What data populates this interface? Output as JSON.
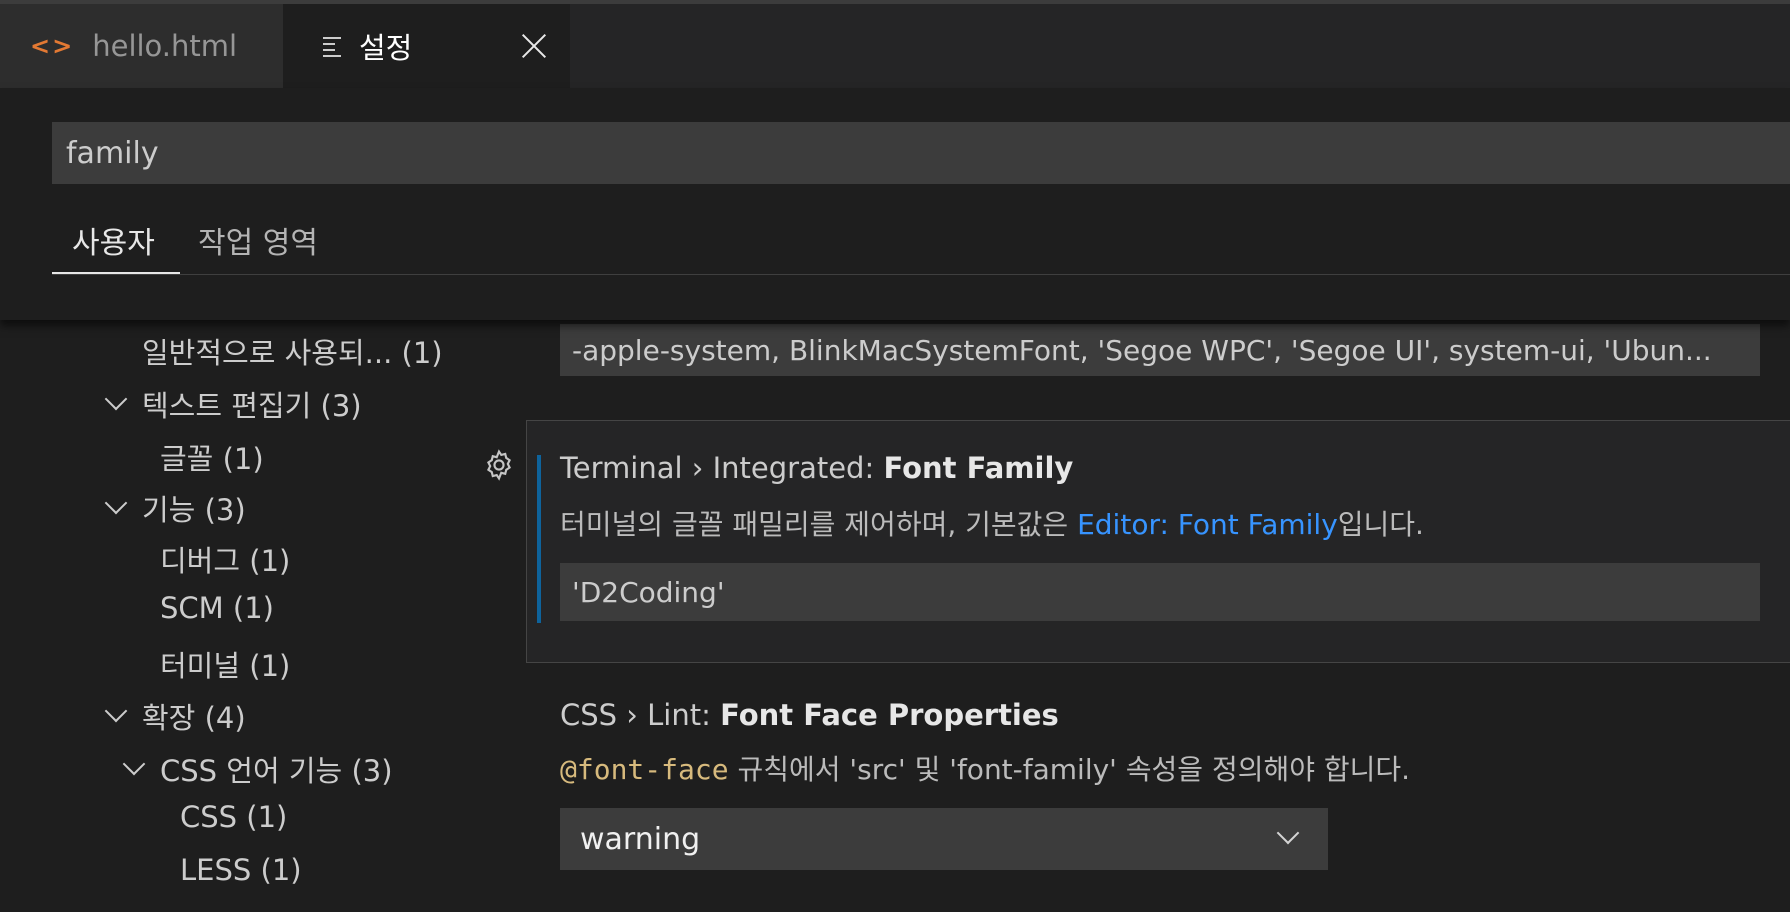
{
  "tabs": {
    "hello": {
      "label": "hello.html",
      "icon": "code-icon"
    },
    "settings": {
      "label": "설정",
      "icon": "settings-lines-icon"
    }
  },
  "search": {
    "value": "family"
  },
  "scope_tabs": {
    "user": "사용자",
    "workspace": "작업 영역"
  },
  "toc": {
    "items": [
      {
        "label": "일반적으로 사용되... (1)"
      },
      {
        "label": "텍스트 편집기 (3)"
      },
      {
        "label": "글꼴 (1)"
      },
      {
        "label": "기능 (3)"
      },
      {
        "label": "디버그 (1)"
      },
      {
        "label": "SCM (1)"
      },
      {
        "label": "터미널 (1)"
      },
      {
        "label": "확장 (4)"
      },
      {
        "label": "CSS 언어 기능 (3)"
      },
      {
        "label": "CSS (1)"
      },
      {
        "label": "LESS (1)"
      }
    ]
  },
  "settings": {
    "editor_font_family": {
      "value": "-apple-system, BlinkMacSystemFont, 'Segoe WPC', 'Segoe UI', system-ui, 'Ubun..."
    },
    "terminal_font_family": {
      "category": "Terminal › Integrated: ",
      "name": "Font Family",
      "desc_prefix": "터미널의 글꼴 패밀리를 제어하며, 기본값은 ",
      "desc_link": "Editor: Font Family",
      "desc_suffix": "입니다.",
      "value": "'D2Coding'"
    },
    "css_font_face": {
      "category": "CSS › Lint: ",
      "name": "Font Face Properties",
      "desc_code": "@font-face",
      "desc_rest": " 규칙에서 'src' 및 'font-family' 속성을 정의해야 합니다.",
      "value": "warning"
    }
  },
  "colors": {
    "accent_link": "#3794ff",
    "focus_bar": "#0e639c",
    "code_text": "#d7ba7d",
    "html_icon": "#e37933"
  }
}
